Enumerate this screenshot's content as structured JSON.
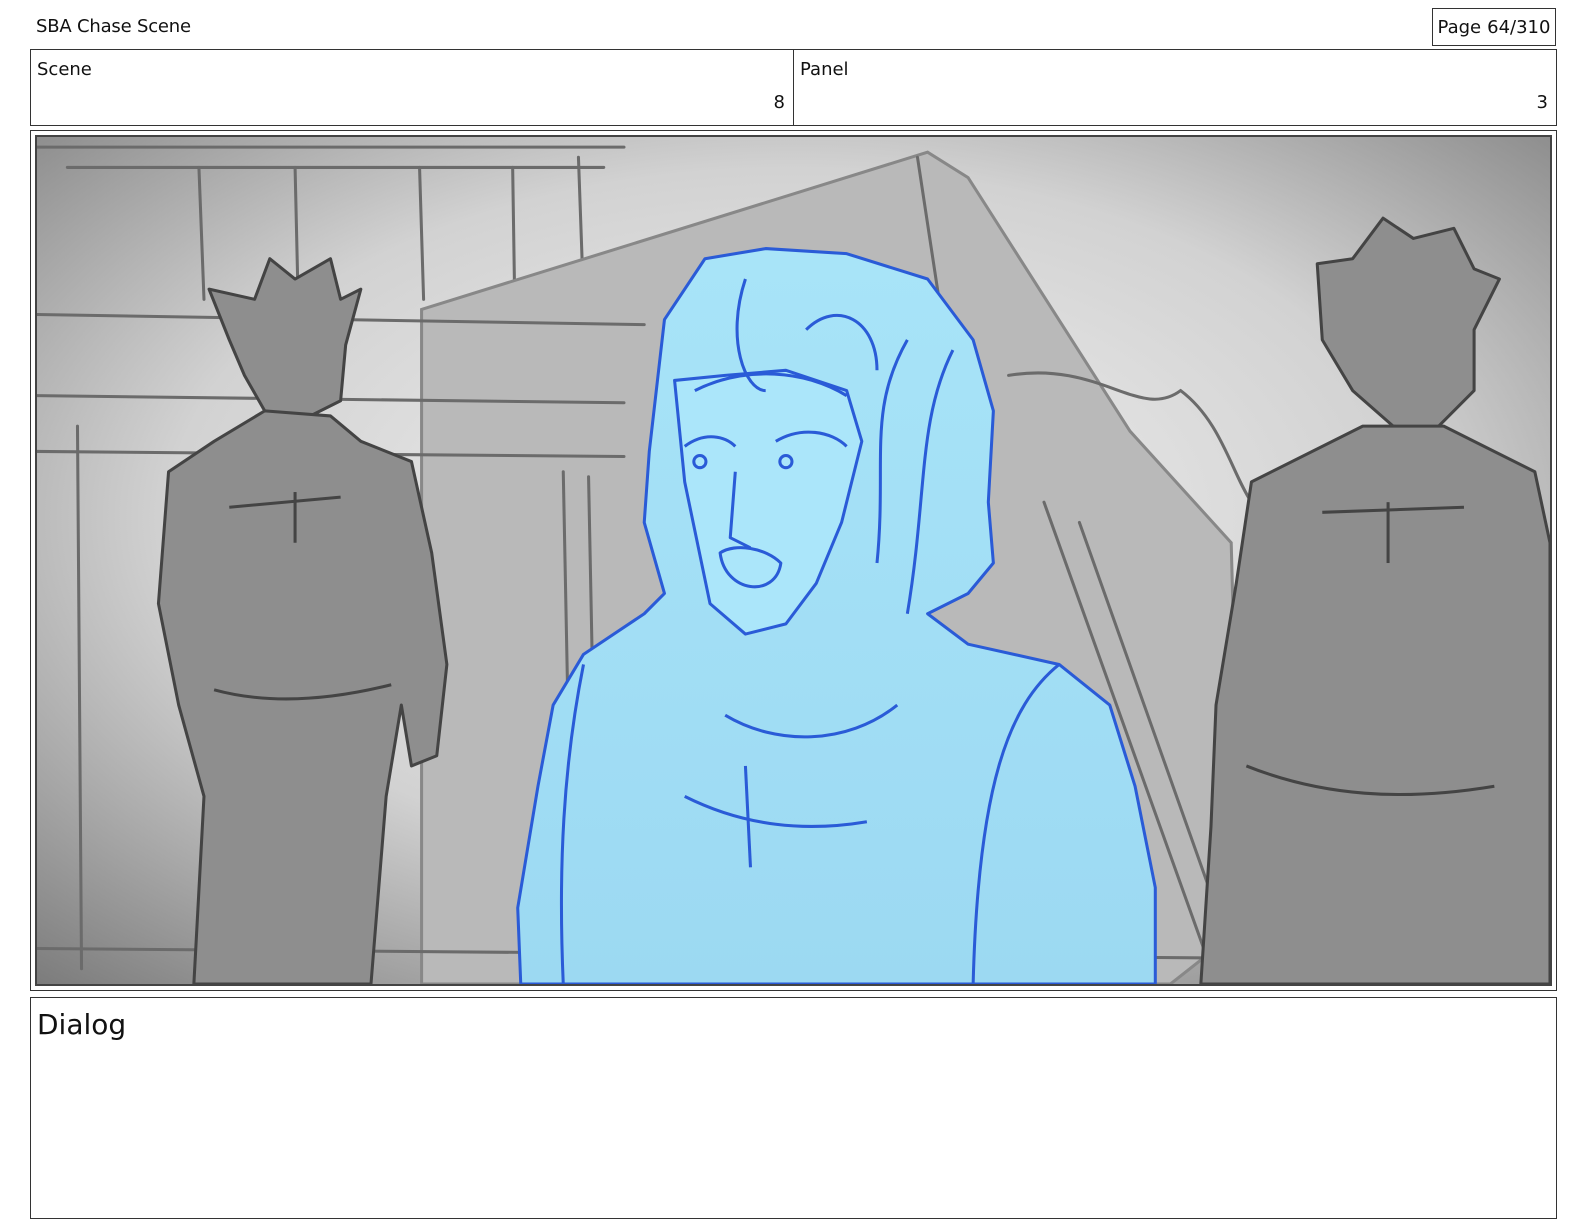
{
  "header": {
    "project_title": "SBA Chase Scene",
    "page_label": "Page",
    "page_number": "64/310"
  },
  "info": {
    "scene_label": "Scene",
    "scene_value": "8",
    "panel_label": "Panel",
    "panel_value": "3"
  },
  "panel": {
    "foreground_color": "#a8e4f8",
    "foreground_line_color": "#2a5bd7",
    "background_tone": "#bdbdbd",
    "figure_tone": "#8e8e8e"
  },
  "dialog": {
    "label": "Dialog"
  }
}
